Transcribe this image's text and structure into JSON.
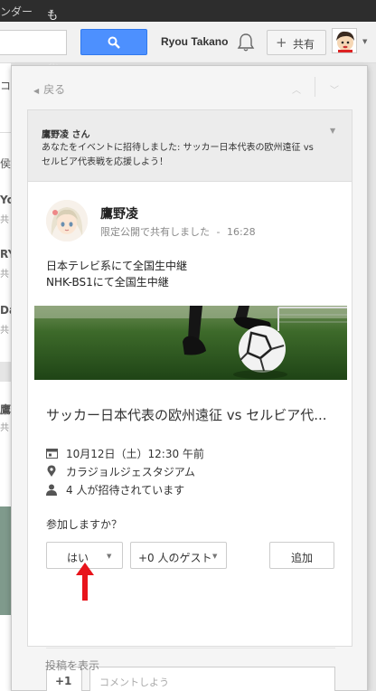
{
  "topbar": {
    "item1": "ンダー",
    "item2": "もっと見る",
    "caret": "▾"
  },
  "header": {
    "username": "Ryou Takano",
    "share_label": "共有",
    "share_plus": "+",
    "avatar_caret": "▼"
  },
  "bg_fragments": [
    "コ",
    "侯",
    "Yo",
    "共",
    "RY",
    "共",
    "Da",
    "共",
    "鷹",
    "共"
  ],
  "panel": {
    "back_label": "戻る",
    "notification": {
      "sender": "鷹野凌 さん",
      "message": "あなたをイベントに招待しました: サッカー日本代表の欧州遠征 vs セルビア代表戦を応援しよう！"
    },
    "post": {
      "author": "鷹野凌",
      "visibility": "限定公開で共有しました",
      "separator": "-",
      "time": "16:28",
      "text_line1": "日本テレビ系にて全国生中継",
      "text_line2": "NHK-BS1にて全国生中継"
    },
    "event": {
      "title": "サッカー日本代表の欧州遠征 vs セルビア代...",
      "date": "10月12日（土）12:30 午前",
      "location": "カラジョルジェスタジアム",
      "invited": "4 人が招待されています"
    },
    "rsvp": {
      "question": "参加しますか？",
      "yes_label": "はい",
      "guests_label": "+0 人のゲスト",
      "add_label": "追加"
    },
    "plus_one": "+1",
    "comment_placeholder": "コメントしよう",
    "show_posts": "投稿を表示"
  },
  "colors": {
    "search_blue": "#4d90fe",
    "annotation_red": "#e8141b"
  },
  "icons": [
    "search-icon",
    "bell-icon",
    "calendar-icon",
    "location-pin-icon",
    "person-icon",
    "chevron-up-icon",
    "chevron-down-icon"
  ]
}
